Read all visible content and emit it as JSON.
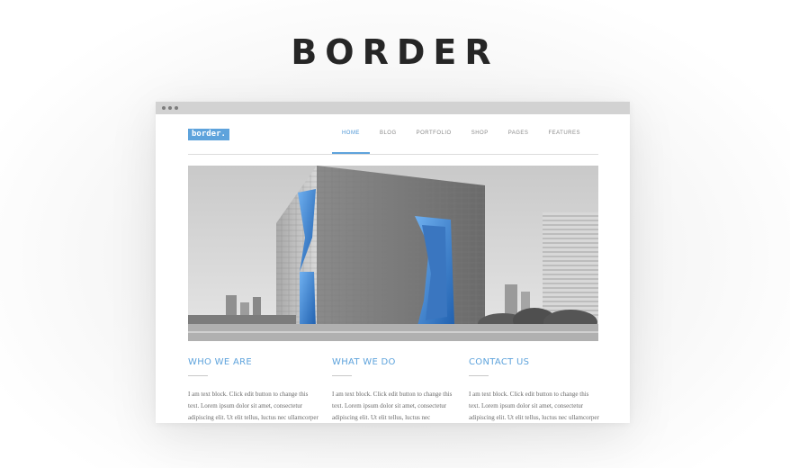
{
  "hero": {
    "title": "BORDER"
  },
  "site": {
    "logo": "border.",
    "nav": [
      {
        "label": "HOME",
        "active": true
      },
      {
        "label": "BLOG",
        "active": false
      },
      {
        "label": "PORTFOLIO",
        "active": false
      },
      {
        "label": "SHOP",
        "active": false
      },
      {
        "label": "PAGES",
        "active": false
      },
      {
        "label": "FEATURES",
        "active": false
      }
    ],
    "columns": [
      {
        "heading": "WHO WE ARE",
        "text": "I am text block. Click edit button to change this text. Lorem ipsum dolor sit amet, consectetur adipiscing elit. Ut elit tellus, luctus nec ullamcorper mattis,"
      },
      {
        "heading": "WHAT WE DO",
        "text": "I am text block. Click edit button to change this text. Lorem ipsum dolor sit amet, consectetur adipiscing elit. Ut elit tellus, luctus nec"
      },
      {
        "heading": "CONTACT US",
        "text": "I am text block. Click edit button to change this text. Lorem ipsum dolor sit amet, consectetur adipiscing elit. Ut elit tellus, luctus nec ullamcorper mattis,"
      }
    ]
  },
  "colors": {
    "accent": "#5ea3dc",
    "title": "#262626",
    "chrome": "#d2d2d2"
  }
}
